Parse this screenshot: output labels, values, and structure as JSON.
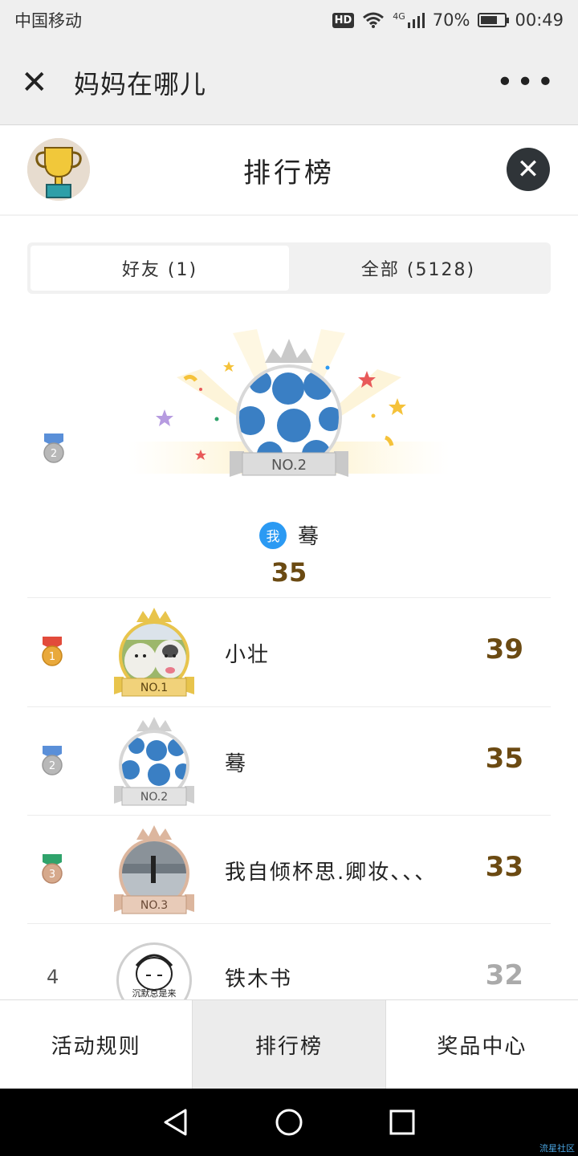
{
  "status_bar": {
    "carrier": "中国移动",
    "hd": "HD",
    "network": "4G",
    "battery_percent": "70%",
    "battery_level": 0.7,
    "time": "00:49"
  },
  "app_header": {
    "title": "妈妈在哪儿",
    "more": "•••"
  },
  "rank_header": {
    "title": "排行榜"
  },
  "tabs": [
    {
      "label": "好友 (1)",
      "active": true
    },
    {
      "label": "全部 (5128)",
      "active": false
    }
  ],
  "my_entry": {
    "rank": "2",
    "badge_label": "NO.2",
    "me_tag": "我",
    "name": "蓦",
    "score": "35"
  },
  "rows": [
    {
      "rank": "1",
      "badge_label": "NO.1",
      "name": "小壮",
      "score": "39",
      "medal_color": "#e9a93b",
      "ribbon": "#e24b3b"
    },
    {
      "rank": "2",
      "badge_label": "NO.2",
      "name": "蓦",
      "score": "35",
      "medal_color": "#b8b8b8",
      "ribbon": "#5a8fd8"
    },
    {
      "rank": "3",
      "badge_label": "NO.3",
      "name": "我自倾杯思.卿妆、、、",
      "score": "33",
      "medal_color": "#d6a98c",
      "ribbon": "#2fa36b"
    },
    {
      "rank": "4",
      "badge_label": "沉默总是来",
      "name": "铁木书",
      "score": "32"
    }
  ],
  "bottom_nav": [
    {
      "label": "活动规则",
      "active": false
    },
    {
      "label": "排行榜",
      "active": true
    },
    {
      "label": "奖品中心",
      "active": false
    }
  ],
  "watermark": "流星社区",
  "colors": {
    "score": "#6b4a12",
    "me_badge": "#2b9af3",
    "gold": "#e9c05a",
    "silver": "#c9c9c9",
    "bronze": "#d9b49b"
  }
}
